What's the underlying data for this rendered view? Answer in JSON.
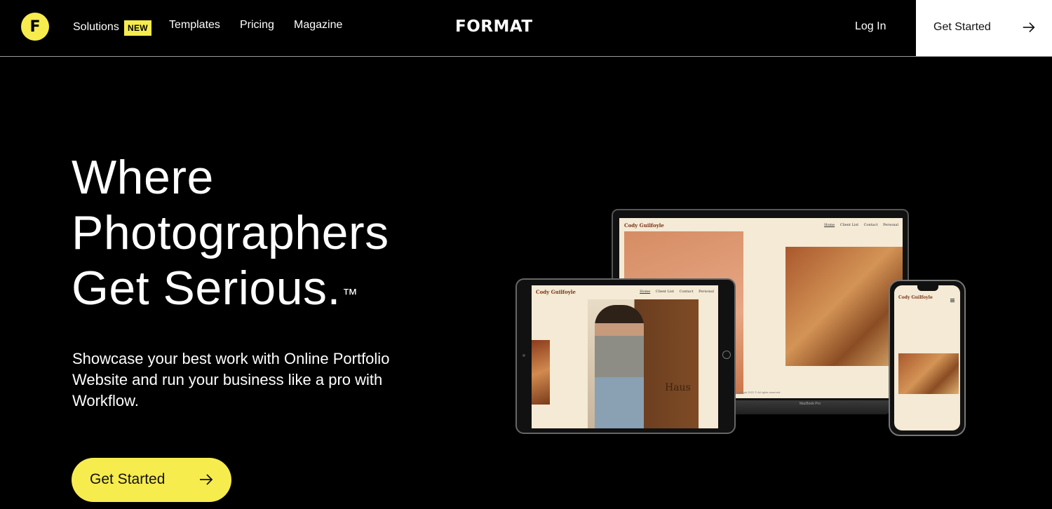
{
  "nav": {
    "logo_letter": "F",
    "solutions_label": "Solutions",
    "new_badge": "NEW",
    "templates_label": "Templates",
    "pricing_label": "Pricing",
    "magazine_label": "Magazine",
    "brand": "FORMAT",
    "login_label": "Log In",
    "cta_label": "Get Started"
  },
  "hero": {
    "title_lines": [
      "Where",
      "Photographers",
      "Get Serious."
    ],
    "trademark": "™",
    "subtitle": "Showcase your best work with Online Portfolio Website and run your business like a pro with Workflow.",
    "cta_label": "Get Started"
  },
  "mockups": {
    "site_name": "Cody Guilfoyle",
    "site_nav": [
      "Home",
      "Client List",
      "Contact",
      "Personal"
    ],
    "laptop_footer": "Copyright 2022 © All rights reserved.",
    "laptop_model": "MacBook Pro",
    "tablet_sign": "Haus"
  },
  "colors": {
    "accent_yellow": "#f7ec4e",
    "background": "#000000",
    "text": "#ffffff"
  }
}
